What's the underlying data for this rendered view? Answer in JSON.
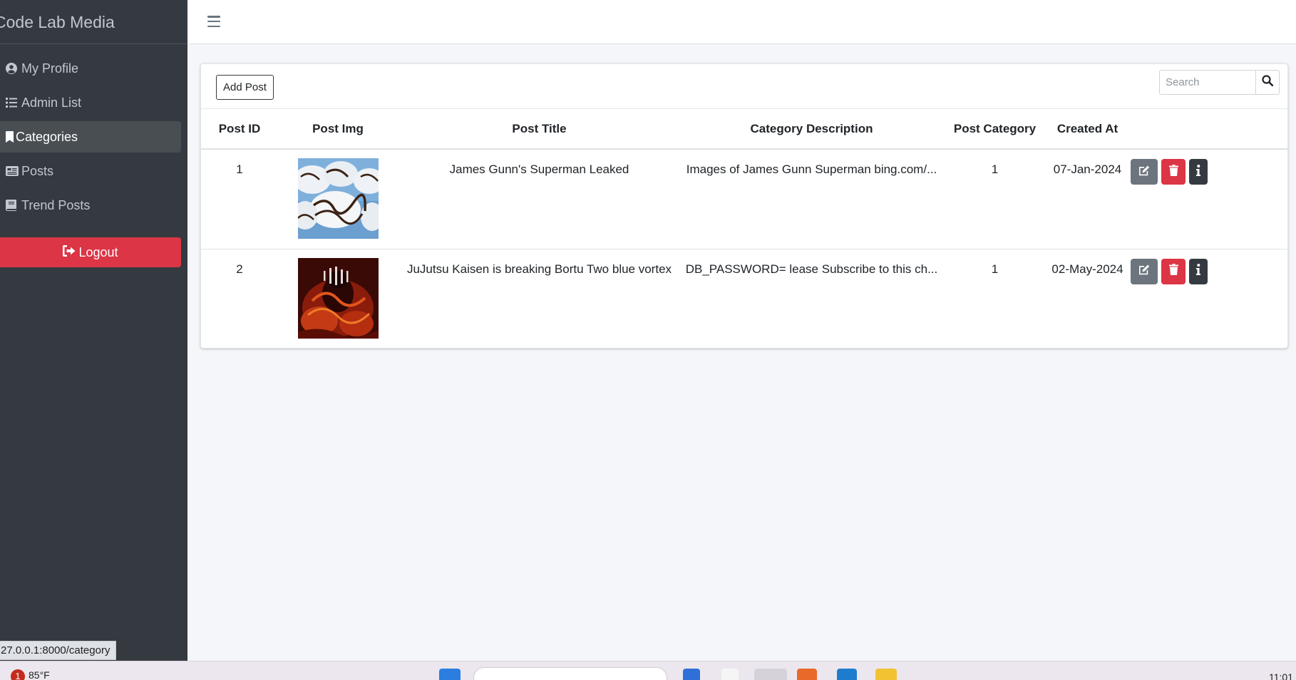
{
  "brand": "Code Lab Media",
  "sidebar": {
    "items": [
      {
        "label": "My Profile",
        "icon": "user-circle-icon"
      },
      {
        "label": "Admin List",
        "icon": "list-icon"
      },
      {
        "label": "Categories",
        "icon": "bookmark-icon",
        "active": true
      },
      {
        "label": "Posts",
        "icon": "newspaper-icon"
      },
      {
        "label": "Trend Posts",
        "icon": "book-icon"
      }
    ],
    "logout_label": "Logout"
  },
  "toolbar": {
    "add_label": "Add Post",
    "search_placeholder": "Search"
  },
  "table": {
    "headers": [
      "Post ID",
      "Post Img",
      "Post Title",
      "Category Description",
      "Post Category",
      "Created At",
      ""
    ],
    "rows": [
      {
        "id": "1",
        "image": "chocolate-drizzle-truffles",
        "title": "James Gunn's Superman Leaked",
        "description": "Images of James Gunn Superman bing.com/...",
        "category": "1",
        "created_at": "07-Jan-2024"
      },
      {
        "id": "2",
        "image": "anime-poster-red",
        "title": "JuJutsu Kaisen is breaking Bortu Two blue vortex",
        "description": "DB_PASSWORD= lease Subscribe to this ch...",
        "category": "1",
        "created_at": "02-May-2024"
      }
    ]
  },
  "status_url": "27.0.0.1:8000/category",
  "taskbar": {
    "badge": "1",
    "temperature": "85°F",
    "clock": "11:01"
  },
  "colors": {
    "sidebar": "#343a40",
    "danger": "#dc3545",
    "secondary": "#6c757d",
    "dark": "#343a40"
  }
}
